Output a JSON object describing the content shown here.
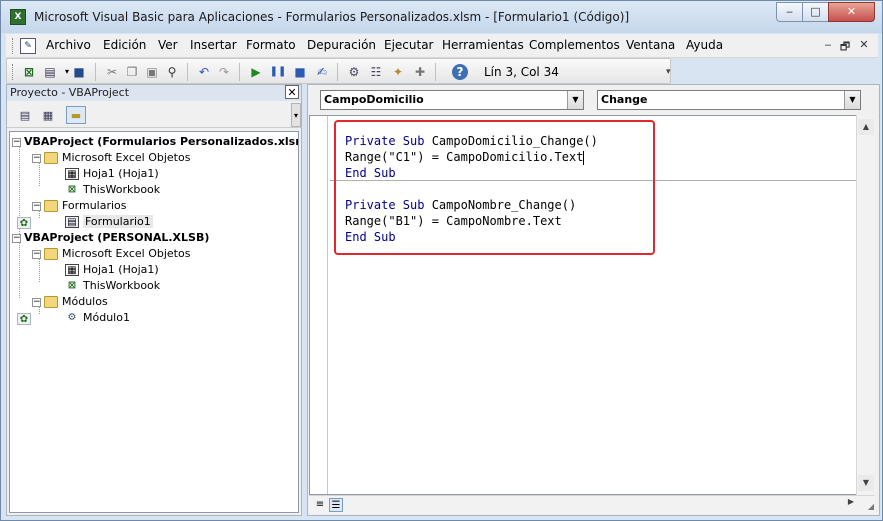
{
  "window": {
    "title": "Microsoft Visual Basic para Aplicaciones - Formularios Personalizados.xlsm - [Formulario1 (Código)]",
    "app_icon_glyph": "X",
    "controls": {
      "minimize": "‒",
      "maximize": "□",
      "close": "✕"
    }
  },
  "menu": {
    "items": [
      "Archivo",
      "Edición",
      "Ver",
      "Insertar",
      "Formato",
      "Depuración",
      "Ejecutar",
      "Herramientas",
      "Complementos",
      "Ventana",
      "Ayuda"
    ],
    "mdi_controls": {
      "minimize": "‒",
      "restore": "🗗",
      "close": "✕"
    }
  },
  "toolbar": {
    "status": "Lín 3, Col 34",
    "icons": [
      "excel-icon",
      "insert-userform-icon",
      "save-icon",
      "cut-icon",
      "copy-icon",
      "paste-icon",
      "find-icon",
      "undo-icon",
      "redo-icon",
      "run-icon",
      "break-icon",
      "reset-icon",
      "design-mode-icon",
      "project-explorer-icon",
      "properties-icon",
      "object-browser-icon",
      "toolbox-icon",
      "help-icon"
    ]
  },
  "project_panel": {
    "title": "Proyecto - VBAProject",
    "close_glyph": "✕",
    "tree": [
      {
        "label": "VBAProject (Formularios Personalizados.xlsm)",
        "bold": true
      },
      {
        "label": "Microsoft Excel Objetos"
      },
      {
        "label": "Hoja1 (Hoja1)"
      },
      {
        "label": "ThisWorkbook"
      },
      {
        "label": "Formularios"
      },
      {
        "label": "Formulario1",
        "selected": true
      },
      {
        "label": "VBAProject (PERSONAL.XLSB)",
        "bold": true
      },
      {
        "label": "Microsoft Excel Objetos"
      },
      {
        "label": "Hoja1 (Hoja1)"
      },
      {
        "label": "ThisWorkbook"
      },
      {
        "label": "Módulos"
      },
      {
        "label": "Módulo1"
      }
    ]
  },
  "code_window": {
    "object_combo": "CampoDomicilio",
    "procedure_combo": "Change",
    "lines": [
      {
        "kw1": "Private Sub",
        "rest": " CampoDomicilio_Change()"
      },
      {
        "plain": "Range(\"C1\") = CampoDomicilio.Text"
      },
      {
        "kw1": "End Sub",
        "rest": ""
      },
      {
        "kw1": "Private Sub",
        "rest": " CampoNombre_Change()"
      },
      {
        "plain": "Range(\"B1\") = CampoNombre.Text"
      },
      {
        "kw1": "End Sub",
        "rest": ""
      }
    ]
  },
  "colors": {
    "keyword": "#00008b",
    "highlight_border": "#e0282e"
  }
}
